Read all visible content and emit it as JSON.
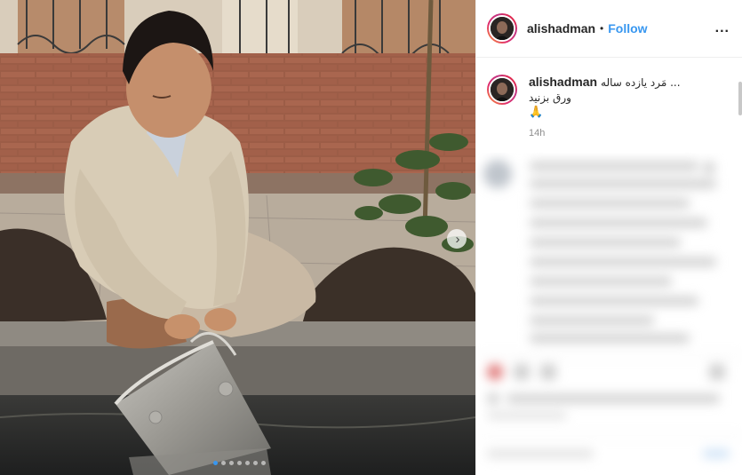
{
  "post": {
    "username": "alishadman",
    "bullet": "•",
    "follow_label": "Follow",
    "more_label": "...",
    "caption": {
      "username": "alishadman",
      "text_line1": "... مَرد یازده ساله",
      "text_line2": "ورق بزنید",
      "emoji": "🙏"
    },
    "timestamp": "14h",
    "carousel": {
      "total_slides": 7,
      "active_slide": 1,
      "next_icon": "chevron-right-icon"
    }
  },
  "colors": {
    "accent": "#3897f0",
    "text": "#262626",
    "muted": "#8e8e8e"
  }
}
